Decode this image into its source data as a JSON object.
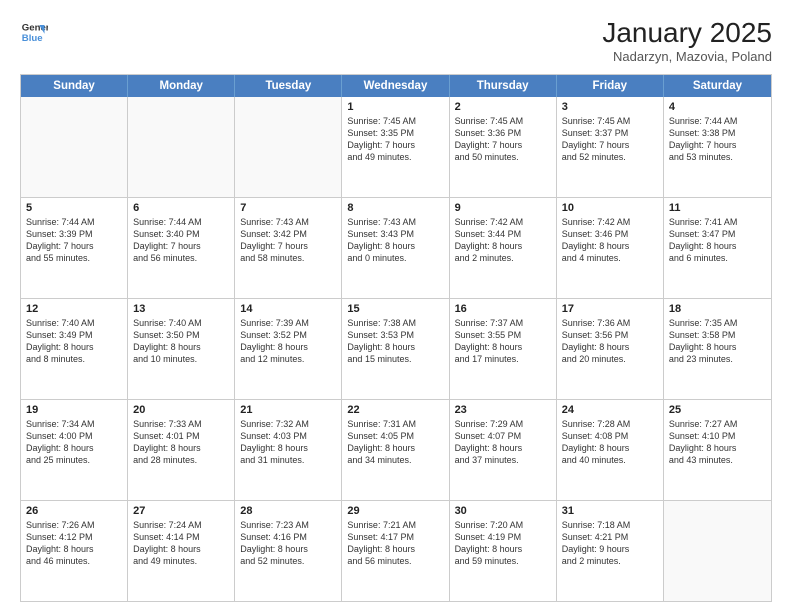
{
  "header": {
    "logo_line1": "General",
    "logo_line2": "Blue",
    "month_title": "January 2025",
    "subtitle": "Nadarzyn, Mazovia, Poland"
  },
  "days_of_week": [
    "Sunday",
    "Monday",
    "Tuesday",
    "Wednesday",
    "Thursday",
    "Friday",
    "Saturday"
  ],
  "weeks": [
    [
      {
        "day": "",
        "info": ""
      },
      {
        "day": "",
        "info": ""
      },
      {
        "day": "",
        "info": ""
      },
      {
        "day": "1",
        "info": "Sunrise: 7:45 AM\nSunset: 3:35 PM\nDaylight: 7 hours\nand 49 minutes."
      },
      {
        "day": "2",
        "info": "Sunrise: 7:45 AM\nSunset: 3:36 PM\nDaylight: 7 hours\nand 50 minutes."
      },
      {
        "day": "3",
        "info": "Sunrise: 7:45 AM\nSunset: 3:37 PM\nDaylight: 7 hours\nand 52 minutes."
      },
      {
        "day": "4",
        "info": "Sunrise: 7:44 AM\nSunset: 3:38 PM\nDaylight: 7 hours\nand 53 minutes."
      }
    ],
    [
      {
        "day": "5",
        "info": "Sunrise: 7:44 AM\nSunset: 3:39 PM\nDaylight: 7 hours\nand 55 minutes."
      },
      {
        "day": "6",
        "info": "Sunrise: 7:44 AM\nSunset: 3:40 PM\nDaylight: 7 hours\nand 56 minutes."
      },
      {
        "day": "7",
        "info": "Sunrise: 7:43 AM\nSunset: 3:42 PM\nDaylight: 7 hours\nand 58 minutes."
      },
      {
        "day": "8",
        "info": "Sunrise: 7:43 AM\nSunset: 3:43 PM\nDaylight: 8 hours\nand 0 minutes."
      },
      {
        "day": "9",
        "info": "Sunrise: 7:42 AM\nSunset: 3:44 PM\nDaylight: 8 hours\nand 2 minutes."
      },
      {
        "day": "10",
        "info": "Sunrise: 7:42 AM\nSunset: 3:46 PM\nDaylight: 8 hours\nand 4 minutes."
      },
      {
        "day": "11",
        "info": "Sunrise: 7:41 AM\nSunset: 3:47 PM\nDaylight: 8 hours\nand 6 minutes."
      }
    ],
    [
      {
        "day": "12",
        "info": "Sunrise: 7:40 AM\nSunset: 3:49 PM\nDaylight: 8 hours\nand 8 minutes."
      },
      {
        "day": "13",
        "info": "Sunrise: 7:40 AM\nSunset: 3:50 PM\nDaylight: 8 hours\nand 10 minutes."
      },
      {
        "day": "14",
        "info": "Sunrise: 7:39 AM\nSunset: 3:52 PM\nDaylight: 8 hours\nand 12 minutes."
      },
      {
        "day": "15",
        "info": "Sunrise: 7:38 AM\nSunset: 3:53 PM\nDaylight: 8 hours\nand 15 minutes."
      },
      {
        "day": "16",
        "info": "Sunrise: 7:37 AM\nSunset: 3:55 PM\nDaylight: 8 hours\nand 17 minutes."
      },
      {
        "day": "17",
        "info": "Sunrise: 7:36 AM\nSunset: 3:56 PM\nDaylight: 8 hours\nand 20 minutes."
      },
      {
        "day": "18",
        "info": "Sunrise: 7:35 AM\nSunset: 3:58 PM\nDaylight: 8 hours\nand 23 minutes."
      }
    ],
    [
      {
        "day": "19",
        "info": "Sunrise: 7:34 AM\nSunset: 4:00 PM\nDaylight: 8 hours\nand 25 minutes."
      },
      {
        "day": "20",
        "info": "Sunrise: 7:33 AM\nSunset: 4:01 PM\nDaylight: 8 hours\nand 28 minutes."
      },
      {
        "day": "21",
        "info": "Sunrise: 7:32 AM\nSunset: 4:03 PM\nDaylight: 8 hours\nand 31 minutes."
      },
      {
        "day": "22",
        "info": "Sunrise: 7:31 AM\nSunset: 4:05 PM\nDaylight: 8 hours\nand 34 minutes."
      },
      {
        "day": "23",
        "info": "Sunrise: 7:29 AM\nSunset: 4:07 PM\nDaylight: 8 hours\nand 37 minutes."
      },
      {
        "day": "24",
        "info": "Sunrise: 7:28 AM\nSunset: 4:08 PM\nDaylight: 8 hours\nand 40 minutes."
      },
      {
        "day": "25",
        "info": "Sunrise: 7:27 AM\nSunset: 4:10 PM\nDaylight: 8 hours\nand 43 minutes."
      }
    ],
    [
      {
        "day": "26",
        "info": "Sunrise: 7:26 AM\nSunset: 4:12 PM\nDaylight: 8 hours\nand 46 minutes."
      },
      {
        "day": "27",
        "info": "Sunrise: 7:24 AM\nSunset: 4:14 PM\nDaylight: 8 hours\nand 49 minutes."
      },
      {
        "day": "28",
        "info": "Sunrise: 7:23 AM\nSunset: 4:16 PM\nDaylight: 8 hours\nand 52 minutes."
      },
      {
        "day": "29",
        "info": "Sunrise: 7:21 AM\nSunset: 4:17 PM\nDaylight: 8 hours\nand 56 minutes."
      },
      {
        "day": "30",
        "info": "Sunrise: 7:20 AM\nSunset: 4:19 PM\nDaylight: 8 hours\nand 59 minutes."
      },
      {
        "day": "31",
        "info": "Sunrise: 7:18 AM\nSunset: 4:21 PM\nDaylight: 9 hours\nand 2 minutes."
      },
      {
        "day": "",
        "info": ""
      }
    ]
  ]
}
